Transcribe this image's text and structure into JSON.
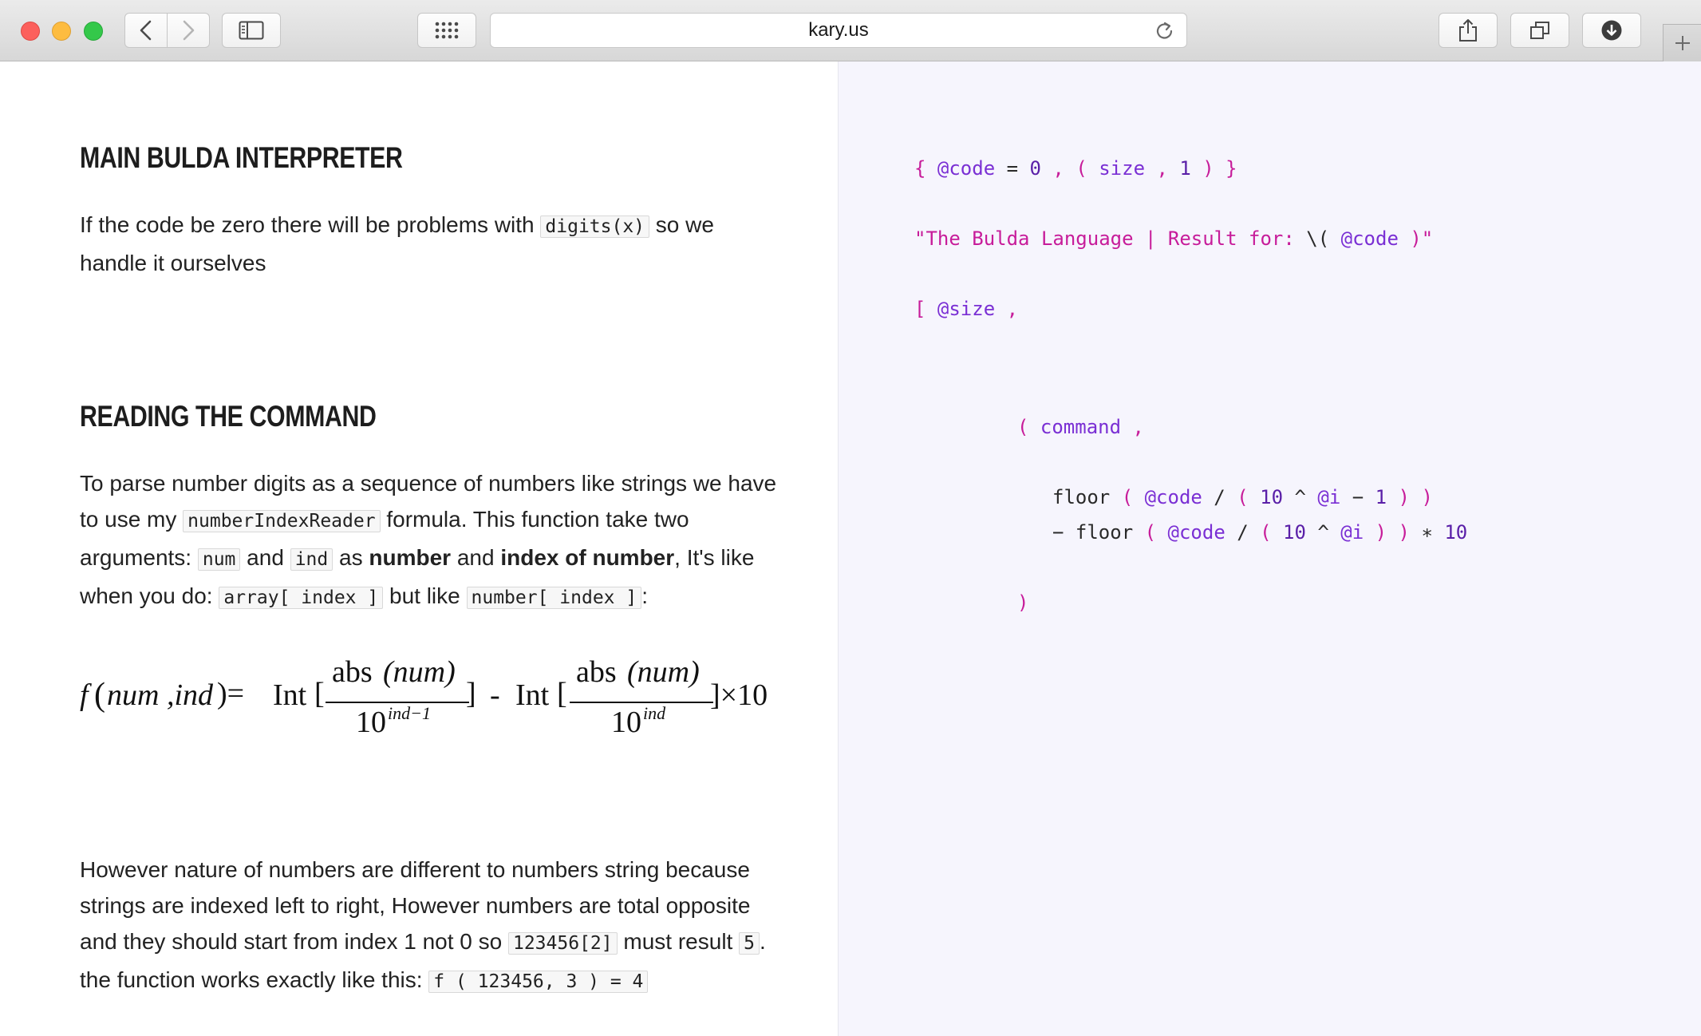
{
  "browser": {
    "url": "kary.us"
  },
  "article": {
    "section1": {
      "title": "MAIN BULDA INTERPRETER",
      "text_before": "If the code be zero there will be problems with ",
      "code": "digits(x)",
      "text_after": " so we handle it ourselves"
    },
    "section2": {
      "title": "READING THE COMMAND",
      "p1_a": "To parse number digits as a sequence of numbers like strings we have to use my ",
      "p1_code1": "numberIndexReader",
      "p1_b": " formula. This function take two arguments: ",
      "p1_code2": "num",
      "p1_c": " and ",
      "p1_code3": "ind",
      "p1_d": " as ",
      "p1_bold1": "number",
      "p1_e": " and ",
      "p1_bold2": "index of number",
      "p1_f": ", It's like when you do: ",
      "p1_code4": "array[ index ]",
      "p1_g": " but like ",
      "p1_code5": "number[ index ]",
      "p1_h": ":",
      "p2_a": "However nature of numbers are different to numbers string because strings are indexed left to right, However numbers are total opposite and they should start from index 1 not 0 so ",
      "p2_code1": "123456[2]",
      "p2_b": " must result ",
      "p2_code2": "5",
      "p2_c": ". the function works exactly like this: ",
      "p2_code3": "f ( 123456, 3 ) = 4"
    },
    "formula": {
      "lhs_f": "f",
      "lhs_open": "(",
      "lhs_args": "num ,ind",
      "lhs_close": ")=",
      "int1": "Int",
      "bracket_open1": "[",
      "num1_abs": "abs",
      "num1_arg": "(num)",
      "den1_base": "10",
      "den1_exp": "ind−1",
      "bracket_close1": "]",
      "minus": "-",
      "int2": "Int",
      "bracket_open2": "[",
      "num2_abs": "abs",
      "num2_arg": "(num)",
      "den2_base": "10",
      "den2_exp": "ind",
      "tail": "]×10"
    }
  },
  "code_panel": {
    "line1": {
      "p1": "{ ",
      "var": "@code",
      "op": " = ",
      "num": "0",
      "p2": " , ( ",
      "id": "size",
      "p3": " , ",
      "num2": "1",
      "p4": " ) }"
    },
    "line2": {
      "s1": "\"The Bulda Language | Result for: ",
      "esc": "\\( ",
      "var": "@code",
      "s2": " )\""
    },
    "line3": {
      "p1": "[ ",
      "var": "@size",
      "p2": " ,"
    },
    "line4": {
      "p1": "( ",
      "id": "command",
      "p2": " ,"
    },
    "line5": {
      "fn": "floor",
      "p1": " ( ",
      "var": "@code",
      "op1": " / ",
      "p2": "( ",
      "num1": "10",
      "op2": " ^ ",
      "var2": "@i",
      "op3": " − ",
      "num2": "1",
      "p3": " ) )"
    },
    "line6": {
      "op0": "− ",
      "fn": "floor",
      "p1": " ( ",
      "var": "@code",
      "op1": " / ",
      "p2": "( ",
      "num1": "10",
      "op2": " ^ ",
      "var2": "@i",
      "p3": " ) )",
      "op3": " ∗ ",
      "num2": "10"
    },
    "line7": {
      "p1": ")"
    }
  },
  "icons": [
    "chevron-left-icon",
    "chevron-right-icon",
    "sidebar-icon",
    "grid-icon",
    "reload-icon",
    "share-icon",
    "tabs-icon",
    "download-icon",
    "plus-icon"
  ],
  "colors": {
    "code_bg": "#f6f5fd",
    "pink": "#c71c9a",
    "purple": "#7a2fd4"
  }
}
